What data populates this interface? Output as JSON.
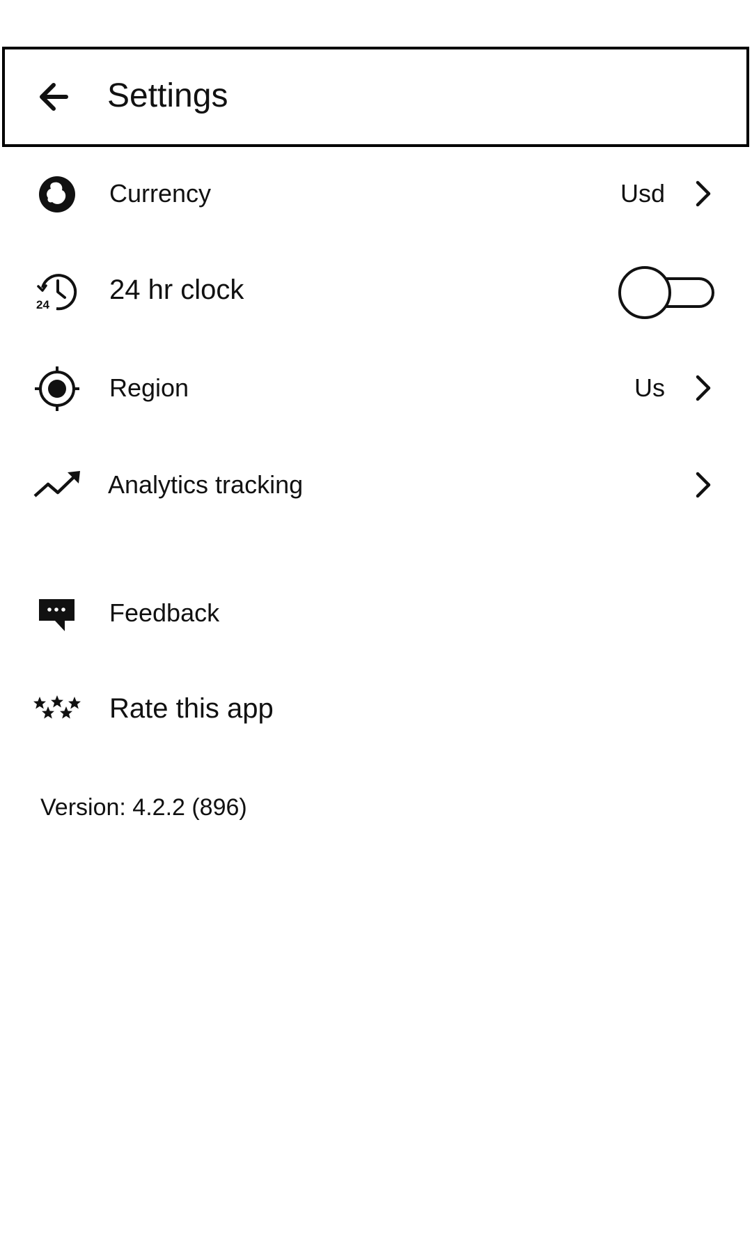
{
  "header": {
    "title": "Settings",
    "back_icon": "arrow-left-icon"
  },
  "settings": {
    "currency": {
      "label": "Currency",
      "value": "Usd",
      "icon": "currency-icon"
    },
    "clock": {
      "label": "24 hr clock",
      "icon": "clock-24-icon",
      "toggle_on": false
    },
    "region": {
      "label": "Region",
      "value": "Us",
      "icon": "location-target-icon"
    },
    "analytics": {
      "label": "Analytics tracking",
      "icon": "trending-up-icon"
    },
    "feedback": {
      "label": "Feedback",
      "icon": "feedback-chat-icon"
    },
    "rate": {
      "label": "Rate this app",
      "icon": "stars-icon"
    }
  },
  "footer": {
    "version": "Version: 4.2.2 (896)"
  }
}
